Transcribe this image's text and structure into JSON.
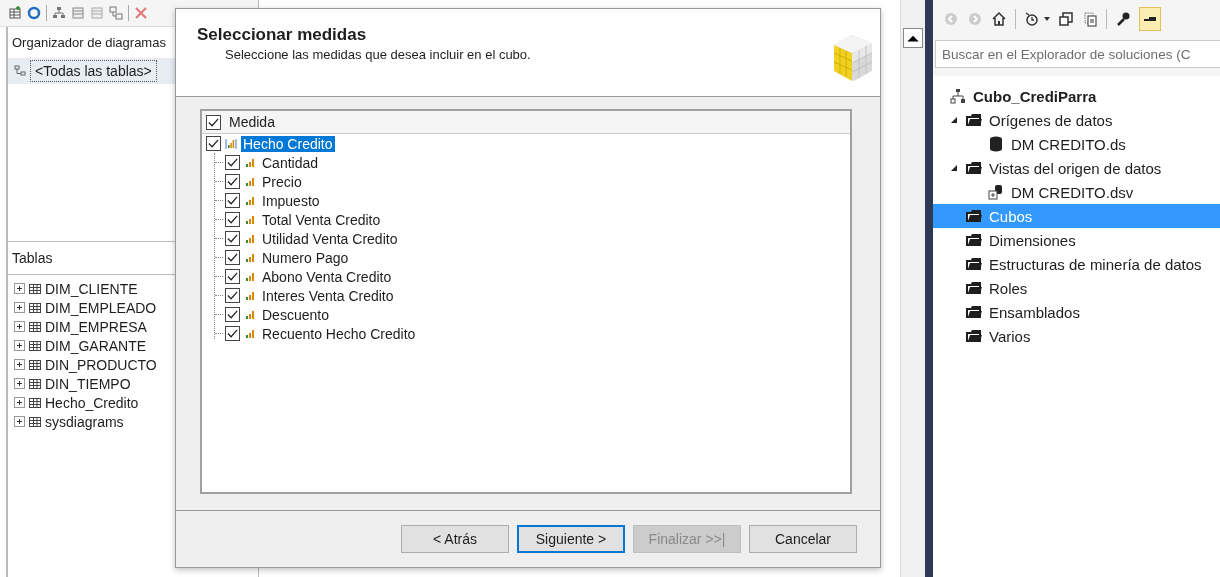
{
  "diagram_organizer": {
    "title": "Organizador de diagramas",
    "items": [
      {
        "label": "<Todas las tablas>",
        "selected": true
      }
    ]
  },
  "tables": {
    "title": "Tablas",
    "items": [
      {
        "label": "DIM_CLIENTE"
      },
      {
        "label": "DIM_EMPLEADO"
      },
      {
        "label": "DIM_EMPRESA"
      },
      {
        "label": "DIM_GARANTE"
      },
      {
        "label": "DIN_PRODUCTO"
      },
      {
        "label": "DIN_TIEMPO"
      },
      {
        "label": "Hecho_Credito"
      },
      {
        "label": "sysdiagrams"
      }
    ]
  },
  "dialog": {
    "title": "Seleccionar medidas",
    "subtitle": "Seleccione las medidas que desea incluir en el cubo.",
    "header": {
      "label": "Medida",
      "checked": true
    },
    "root": {
      "label": "Hecho Credito",
      "checked": true,
      "selected": true,
      "children": [
        {
          "label": "Cantidad",
          "checked": true
        },
        {
          "label": "Precio",
          "checked": true
        },
        {
          "label": "Impuesto",
          "checked": true
        },
        {
          "label": "Total Venta Credito",
          "checked": true
        },
        {
          "label": "Utilidad Venta Credito",
          "checked": true
        },
        {
          "label": "Numero Pago",
          "checked": true
        },
        {
          "label": "Abono Venta Credito",
          "checked": true
        },
        {
          "label": "Interes Venta Credito",
          "checked": true
        },
        {
          "label": "Descuento",
          "checked": true
        },
        {
          "label": "Recuento Hecho Credito",
          "checked": true
        }
      ]
    },
    "buttons": [
      {
        "label": "< Atrás",
        "disabled": false,
        "default": false
      },
      {
        "label": "Siguiente >",
        "disabled": false,
        "default": true
      },
      {
        "label": "Finalizar >>|",
        "disabled": true,
        "default": false
      },
      {
        "label": "Cancelar",
        "disabled": false,
        "default": false
      }
    ]
  },
  "solution_explorer": {
    "search": {
      "placeholder": "Buscar en el Explorador de soluciones (C"
    },
    "root": {
      "label": "Cubo_CrediParra",
      "children": [
        {
          "label": "Orígenes de datos",
          "kind": "folder",
          "selected": false,
          "expanded": true,
          "children": [
            {
              "label": "DM CREDITO.ds",
              "kind": "database",
              "selected": false
            }
          ]
        },
        {
          "label": "Vistas del origen de datos",
          "kind": "folder",
          "selected": false,
          "expanded": true,
          "children": [
            {
              "label": "DM CREDITO.dsv",
              "kind": "view",
              "selected": false
            }
          ]
        },
        {
          "label": "Cubos",
          "kind": "folder",
          "selected": true
        },
        {
          "label": "Dimensiones",
          "kind": "folder",
          "selected": false
        },
        {
          "label": "Estructuras de minería de datos",
          "kind": "folder",
          "selected": false
        },
        {
          "label": "Roles",
          "kind": "folder",
          "selected": false
        },
        {
          "label": "Ensamblados",
          "kind": "folder",
          "selected": false
        },
        {
          "label": "Varios",
          "kind": "folder",
          "selected": false
        }
      ]
    }
  }
}
